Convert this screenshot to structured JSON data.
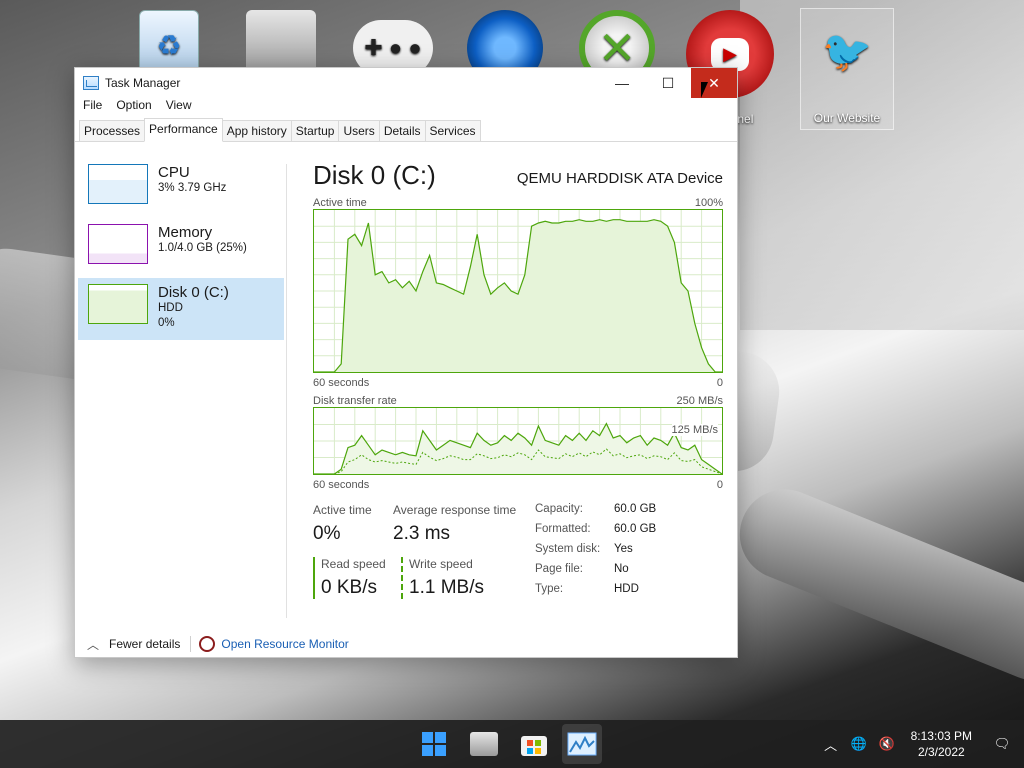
{
  "desktop": {
    "icons": [
      {
        "name": "recycle-bin-icon",
        "label": ""
      },
      {
        "name": "folder-stack-icon",
        "label": ""
      },
      {
        "name": "gamepad-icon",
        "label": ""
      },
      {
        "name": "steam-like-icon",
        "label": ""
      },
      {
        "name": "xbox-icon",
        "label": ""
      },
      {
        "name": "youtube-icon",
        "label": "annel"
      },
      {
        "name": "our-website-icon",
        "label": "Our Website"
      }
    ]
  },
  "window": {
    "title": "Task Manager",
    "controls": {
      "minimize": "—",
      "maximize": "☐",
      "close": "✕"
    },
    "menu": [
      "File",
      "Option",
      "View"
    ],
    "tabs": [
      "Processes",
      "Performance",
      "App history",
      "Startup",
      "Users",
      "Details",
      "Services"
    ],
    "active_tab": "Performance"
  },
  "sidebar": {
    "items": [
      {
        "title": "CPU",
        "line2": "3% 3.79 GHz",
        "line3": "",
        "color": "#1477b9"
      },
      {
        "title": "Memory",
        "line2": "1.0/4.0 GB (25%)",
        "line3": "",
        "color": "#8b12ae"
      },
      {
        "title": "Disk 0 (C:)",
        "line2": "HDD",
        "line3": "0%",
        "color": "#4da60c"
      }
    ]
  },
  "main": {
    "title": "Disk 0 (C:)",
    "device": "QEMU HARDDISK ATA Device",
    "active_graph": {
      "label": "Active time",
      "max": "100%",
      "time": "60 seconds",
      "min": "0"
    },
    "transfer_graph": {
      "label": "Disk transfer rate",
      "max": "250 MB/s",
      "mid": "125 MB/s",
      "time": "60 seconds",
      "min": "0"
    },
    "stats": {
      "active_time_label": "Active time",
      "active_time_value": "0%",
      "response_label": "Average response time",
      "response_value": "2.3 ms",
      "read_label": "Read speed",
      "read_value": "0 KB/s",
      "write_label": "Write speed",
      "write_value": "1.1 MB/s"
    },
    "properties": [
      {
        "k": "Capacity:",
        "v": "60.0 GB"
      },
      {
        "k": "Formatted:",
        "v": "60.0 GB"
      },
      {
        "k": "System disk:",
        "v": "Yes"
      },
      {
        "k": "Page file:",
        "v": "No"
      },
      {
        "k": "Type:",
        "v": "HDD"
      }
    ]
  },
  "footer": {
    "fewer": "Fewer details",
    "monitor": "Open Resource Monitor"
  },
  "taskbar": {
    "apps": [
      "start-icon",
      "file-explorer-icon",
      "store-icon",
      "task-manager-icon"
    ],
    "time": "8:13:03 PM",
    "date": "2/3/2022"
  },
  "chart_data": [
    {
      "type": "area",
      "title": "Active time",
      "ylabel": "",
      "ylim": [
        0,
        100
      ],
      "x": [
        60,
        59,
        58,
        57,
        56,
        55,
        54,
        53,
        52,
        51,
        50,
        49,
        48,
        47,
        46,
        45,
        44,
        43,
        42,
        41,
        40,
        39,
        38,
        37,
        36,
        35,
        34,
        33,
        32,
        31,
        30,
        29,
        28,
        27,
        26,
        25,
        24,
        23,
        22,
        21,
        20,
        19,
        18,
        17,
        16,
        15,
        14,
        13,
        12,
        11,
        10,
        9,
        8,
        7,
        6,
        5,
        4,
        3,
        2,
        1,
        0
      ],
      "series": [
        {
          "values": [
            0,
            0,
            0,
            0,
            5,
            82,
            85,
            78,
            92,
            60,
            62,
            55,
            57,
            52,
            56,
            50,
            62,
            72,
            55,
            54,
            52,
            50,
            48,
            65,
            85,
            60,
            48,
            52,
            55,
            50,
            48,
            60,
            90,
            92,
            93,
            92,
            92,
            93,
            93,
            94,
            93,
            93,
            94,
            93,
            94,
            94,
            93,
            93,
            93,
            93,
            94,
            93,
            90,
            80,
            55,
            50,
            30,
            15,
            5,
            0,
            0
          ]
        }
      ]
    },
    {
      "type": "line",
      "title": "Disk transfer rate",
      "ylabel": "",
      "ylim": [
        0,
        250
      ],
      "x": [
        60,
        59,
        58,
        57,
        56,
        55,
        54,
        53,
        52,
        51,
        50,
        49,
        48,
        47,
        46,
        45,
        44,
        43,
        42,
        41,
        40,
        39,
        38,
        37,
        36,
        35,
        34,
        33,
        32,
        31,
        30,
        29,
        28,
        27,
        26,
        25,
        24,
        23,
        22,
        21,
        20,
        19,
        18,
        17,
        16,
        15,
        14,
        13,
        12,
        11,
        10,
        9,
        8,
        7,
        6,
        5,
        4,
        3,
        2,
        1,
        0
      ],
      "series": [
        {
          "values": [
            0,
            0,
            0,
            0,
            10,
            55,
            60,
            80,
            60,
            40,
            50,
            45,
            40,
            45,
            40,
            38,
            90,
            70,
            50,
            60,
            70,
            65,
            60,
            55,
            85,
            70,
            60,
            65,
            80,
            70,
            85,
            75,
            60,
            100,
            70,
            65,
            60,
            80,
            70,
            85,
            70,
            90,
            80,
            105,
            75,
            80,
            65,
            75,
            80,
            60,
            75,
            70,
            60,
            85,
            55,
            50,
            60,
            30,
            20,
            10,
            0
          ]
        },
        {
          "values": [
            0,
            0,
            0,
            0,
            5,
            25,
            30,
            40,
            30,
            25,
            28,
            25,
            22,
            25,
            22,
            20,
            45,
            35,
            28,
            32,
            38,
            35,
            30,
            30,
            42,
            38,
            32,
            34,
            40,
            36,
            44,
            40,
            30,
            50,
            36,
            34,
            32,
            42,
            36,
            44,
            36,
            46,
            40,
            52,
            38,
            42,
            34,
            38,
            40,
            32,
            38,
            36,
            30,
            44,
            28,
            26,
            30,
            15,
            10,
            5,
            0
          ]
        }
      ]
    }
  ]
}
